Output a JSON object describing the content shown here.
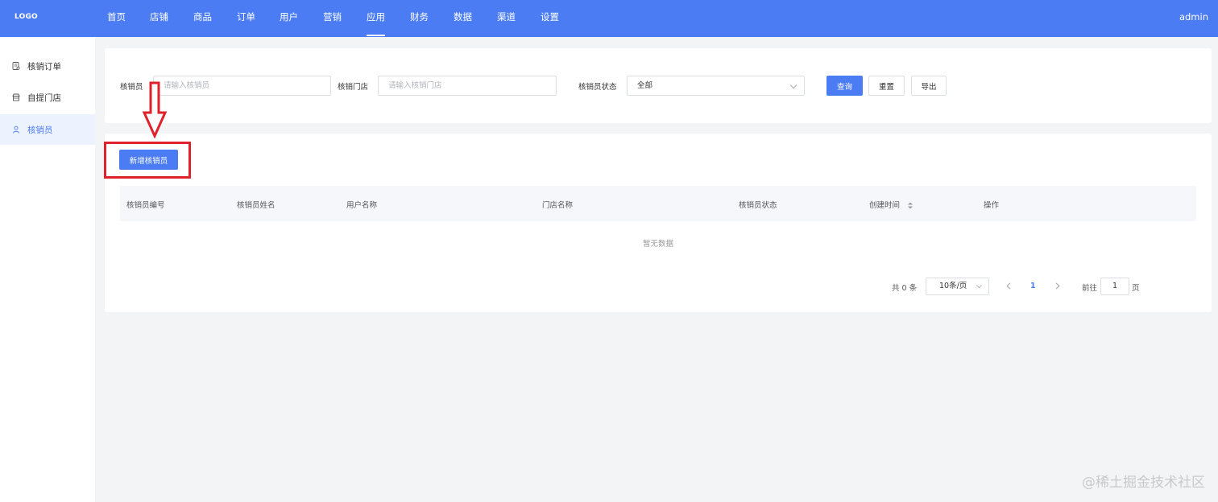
{
  "app": {
    "logo": "LOGO",
    "user": "admin"
  },
  "nav": {
    "items": [
      {
        "label": "首页"
      },
      {
        "label": "店铺"
      },
      {
        "label": "商品"
      },
      {
        "label": "订单"
      },
      {
        "label": "用户"
      },
      {
        "label": "营销"
      },
      {
        "label": "应用"
      },
      {
        "label": "财务"
      },
      {
        "label": "数据"
      },
      {
        "label": "渠道"
      },
      {
        "label": "设置"
      }
    ],
    "active": "应用"
  },
  "sidebar": {
    "items": [
      {
        "label": "核销订单",
        "icon": "order-doc-icon"
      },
      {
        "label": "自提门店",
        "icon": "store-icon"
      },
      {
        "label": "核销员",
        "icon": "user-icon"
      }
    ],
    "active": "核销员"
  },
  "filters": {
    "clerk_label": "核销员",
    "clerk_placeholder": "请输入核销员",
    "store_label": "核销门店",
    "store_placeholder": "请输入核销门店",
    "status_label": "核销员状态",
    "status_value": "全部",
    "search_button": "查询",
    "reset_button": "重置",
    "export_button": "导出"
  },
  "table": {
    "add_button": "新增核销员",
    "columns": [
      "核销员编号",
      "核销员姓名",
      "用户名称",
      "门店名称",
      "核销员状态",
      "创建时间",
      "操作"
    ],
    "sortable_column": "创建时间",
    "empty_text": "暂无数据"
  },
  "pagination": {
    "total_text": "共 0 条",
    "page_size": "10条/页",
    "current_page": "1",
    "goto_prefix": "前往",
    "goto_value": "1",
    "goto_suffix": "页"
  },
  "annotation": {
    "color": "#e0202a"
  },
  "watermark": "@稀土掘金技术社区",
  "colors": {
    "primary": "#4b7cf3",
    "annotation": "#e0202a"
  }
}
